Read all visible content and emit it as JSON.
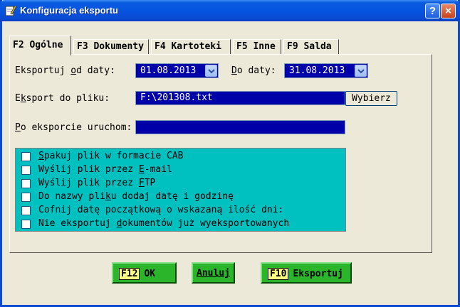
{
  "window": {
    "title": "Konfiguracja eksportu",
    "help_label": "?",
    "close_label": "×"
  },
  "tabs": [
    {
      "label": "F2 Ogólne",
      "active": true
    },
    {
      "label": "F3 Dokumenty",
      "active": false
    },
    {
      "label": "F4 Kartoteki",
      "active": false
    },
    {
      "label": "F5 Inne",
      "active": false
    },
    {
      "label": "F9 Salda",
      "active": false
    }
  ],
  "form": {
    "date_from_label_a": "Eksportuj ",
    "date_from_label_u": "o",
    "date_from_label_b": "d daty:",
    "date_from_value": "01.08.2013",
    "date_to_label_u": "D",
    "date_to_label_b": "o daty:",
    "date_to_value": "31.08.2013",
    "file_label_a": "E",
    "file_label_u": "k",
    "file_label_b": "sport do pliku:",
    "file_value": "F:\\201308.txt",
    "choose_label": "Wybierz",
    "run_label_u": "P",
    "run_label_b": "o eksporcie uruchom:",
    "run_value": ""
  },
  "options": [
    {
      "pre": "",
      "u": "S",
      "post": "pakuj plik w formacie CAB",
      "checked": false
    },
    {
      "pre": "Wyślij plik przez ",
      "u": "E",
      "post": "-mail",
      "checked": false
    },
    {
      "pre": "Wyślij plik przez ",
      "u": "F",
      "post": "TP",
      "checked": false
    },
    {
      "pre": "Do nazwy pli",
      "u": "k",
      "post": "u dodaj datę i godzinę",
      "checked": false
    },
    {
      "pre": "Cofnij datę początkową o wskazaną ilość dni:",
      "u": "",
      "post": "",
      "checked": false
    },
    {
      "pre": "Nie eksportuj ",
      "u": "d",
      "post": "okumentów już wyeksportowanych",
      "checked": false
    }
  ],
  "actions": {
    "ok_key": "F12",
    "ok_label": "OK",
    "cancel_label": "Anuluj",
    "export_key": "F10",
    "export_label": "Eksportuj"
  },
  "colors": {
    "titlebar": "#0a4bd4",
    "field_bg": "#0000a8",
    "options_bg": "#00c0c0",
    "button_green": "#2bb52b",
    "key_highlight": "#ffff80"
  },
  "icons": {
    "title": "pencil-icon",
    "help": "help-icon",
    "close": "close-icon",
    "dropdown": "chevron-down-icon"
  }
}
